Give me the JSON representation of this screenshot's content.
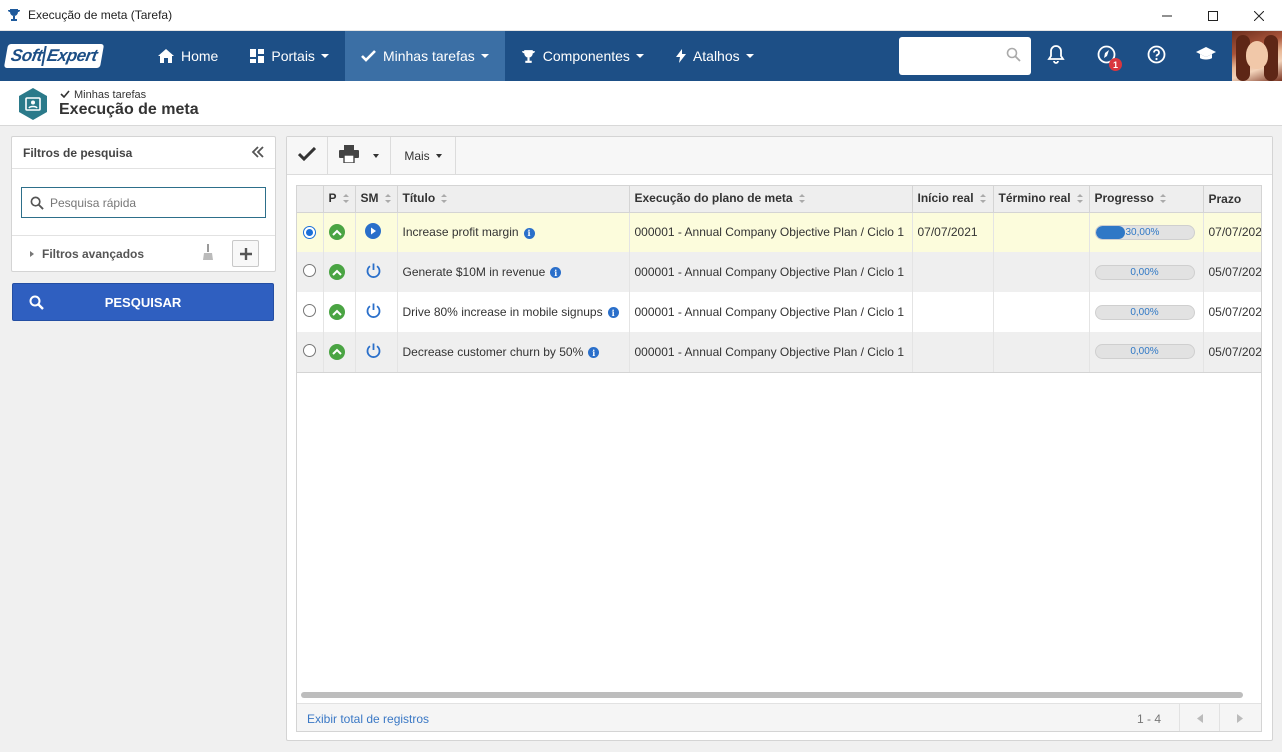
{
  "window": {
    "title": "Execução de meta (Tarefa)"
  },
  "nav": {
    "logo_left": "Soft",
    "logo_right": "Expert",
    "items": [
      {
        "label": "Home",
        "icon": "home-icon"
      },
      {
        "label": "Portais",
        "icon": "portal-grid-icon"
      },
      {
        "label": "Minhas tarefas",
        "icon": "check-icon"
      },
      {
        "label": "Componentes",
        "icon": "trophy-icon"
      },
      {
        "label": "Atalhos",
        "icon": "lightning-icon"
      }
    ],
    "search_placeholder": "",
    "notification_count": "1"
  },
  "page": {
    "breadcrumb": "Minhas tarefas",
    "title": "Execução de meta"
  },
  "filters": {
    "heading": "Filtros de pesquisa",
    "quick_search_placeholder": "Pesquisa rápida",
    "advanced_label": "Filtros avançados",
    "search_button": "PESQUISAR"
  },
  "toolbar": {
    "more_label": "Mais"
  },
  "grid": {
    "columns": [
      "P",
      "SM",
      "Título",
      "Execução do plano de meta",
      "Início real",
      "Término real",
      "Progresso",
      "Prazo"
    ],
    "rows": [
      {
        "title": "Increase profit margin",
        "plan": "000001 - Annual Company Objective Plan / Ciclo 1",
        "start": "07/07/2021",
        "end": "",
        "progress_label": "30,00%",
        "progress": 0.3,
        "deadline": "07/07/202",
        "status": "play",
        "selected": true
      },
      {
        "title": "Generate $10M in revenue",
        "plan": "000001 - Annual Company Objective Plan / Ciclo 1",
        "start": "",
        "end": "",
        "progress_label": "0,00%",
        "progress": 0,
        "deadline": "05/07/202",
        "status": "power",
        "selected": false
      },
      {
        "title": "Drive 80% increase in mobile signups",
        "plan": "000001 - Annual Company Objective Plan / Ciclo 1",
        "start": "",
        "end": "",
        "progress_label": "0,00%",
        "progress": 0,
        "deadline": "05/07/202",
        "status": "power",
        "selected": false
      },
      {
        "title": "Decrease customer churn by 50%",
        "plan": "000001 - Annual Company Objective Plan / Ciclo 1",
        "start": "",
        "end": "",
        "progress_label": "0,00%",
        "progress": 0,
        "deadline": "05/07/202",
        "status": "power",
        "selected": false
      }
    ],
    "footer_total": "Exibir total de registros",
    "page_range": "1 - 4"
  },
  "colors": {
    "nav_bg": "#1d4f86",
    "nav_active": "#3b6fa5",
    "accent_blue": "#2f5fc0",
    "selected_row": "#fcfcdc",
    "priority_green": "#4aa443"
  }
}
